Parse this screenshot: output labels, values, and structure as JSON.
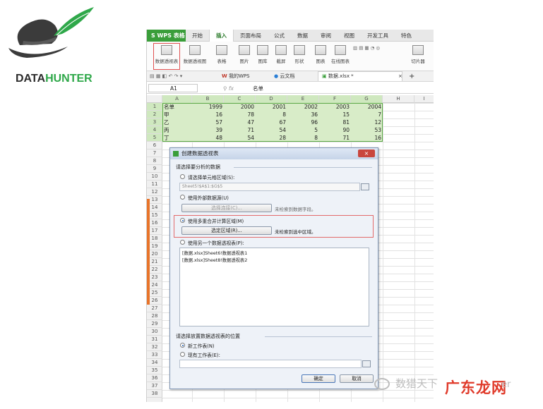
{
  "logo": {
    "text_dark": "DATA",
    "text_green": "HUNTER",
    "image": "hat-with-feather-logo"
  },
  "app": {
    "menu_button": "S WPS 表格",
    "ribbon_tabs": [
      "开始",
      "插入",
      "页面布局",
      "公式",
      "数据",
      "审阅",
      "视图",
      "开发工具",
      "特色"
    ],
    "active_tab": "插入",
    "ribbon_buttons": [
      "数据透视表",
      "数据透视图",
      "表格",
      "图片",
      "图库",
      "截屏",
      "形状",
      "图表",
      "在线图表",
      "切片器"
    ],
    "quick_tabs": [
      "我的WPS",
      "云文档",
      "数据.xlsx *"
    ],
    "name_box": "A1",
    "fx_label": "fx",
    "formula_value": "名单"
  },
  "sheet": {
    "columns": [
      "A",
      "B",
      "C",
      "D",
      "E",
      "F",
      "G",
      "H",
      "I"
    ],
    "row_numbers": [
      "1",
      "2",
      "3",
      "4",
      "5",
      "6",
      "7",
      "8",
      "9",
      "10",
      "11",
      "12",
      "13",
      "14",
      "15",
      "16",
      "17",
      "18",
      "19",
      "20",
      "21",
      "22",
      "23",
      "24",
      "25",
      "26",
      "27",
      "28",
      "29",
      "30",
      "31",
      "32",
      "33",
      "34",
      "35",
      "36",
      "37",
      "38"
    ],
    "table": [
      [
        "名单",
        "1999",
        "2000",
        "2001",
        "2002",
        "2003",
        "2004"
      ],
      [
        "甲",
        "16",
        "78",
        "8",
        "36",
        "15",
        "7"
      ],
      [
        "乙",
        "57",
        "47",
        "67",
        "96",
        "81",
        "12"
      ],
      [
        "丙",
        "39",
        "71",
        "54",
        "5",
        "90",
        "53"
      ],
      [
        "丁",
        "48",
        "54",
        "28",
        "8",
        "71",
        "16"
      ]
    ]
  },
  "dialog": {
    "title": "创建数据透视表",
    "close_label": "×",
    "section1_label": "请选择要分析的数据",
    "opt_cell_range": "请选择单元格区域(S):",
    "cell_range_value": "Sheet5!$A$1:$G$5",
    "opt_external": "使用外部数据源(U)",
    "choose_conn_button": "选择连接(C)...",
    "no_fields_hint": "未检索到数据字段。",
    "opt_multi_consolidation": "使用多重合并计算区域(M)",
    "choose_region_button": "选定区域(R)...",
    "no_region_hint": "未检索到选中区域。",
    "opt_another_pivot": "使用另一个数据透视表(P):",
    "pivot_list": [
      "[数据.xlsx]Sheet6!数据透视表1",
      "[数据.xlsx]Sheet8!数据透视表2"
    ],
    "section2_label": "请选择放置数据透视表的位置",
    "opt_new_sheet": "新工作表(N)",
    "opt_existing_sheet": "现有工作表(E):",
    "ok_button": "确定",
    "cancel_button": "取消"
  },
  "watermark": {
    "text_gray": "数猎天下",
    "text_red": "广东龙网",
    "text_tail": "er"
  }
}
